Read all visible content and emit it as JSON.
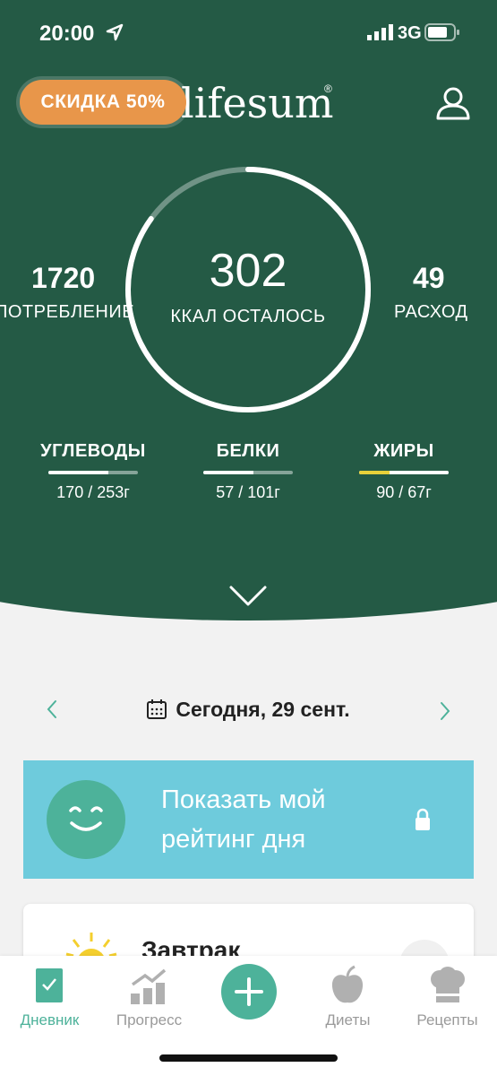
{
  "status_bar": {
    "time": "20:00",
    "network": "3G"
  },
  "header": {
    "promo_label": "СКИДКА 50%",
    "logo_text": "lifesum",
    "calories_remaining": "302",
    "calories_remaining_label": "ККАЛ ОСТАЛОСЬ",
    "consumed_value": "1720",
    "consumed_label": "ПОТРЕБЛЕНИЕ",
    "burned_value": "49",
    "burned_label": "РАСХОД",
    "ring_progress": 0.85,
    "macros": [
      {
        "label": "УГЛЕВОДЫ",
        "value": "170 / 253г",
        "progress": 0.67
      },
      {
        "label": "БЕЛКИ",
        "value": "57 / 101г",
        "progress": 0.56
      },
      {
        "label": "ЖИРЫ",
        "value": "90 / 67г",
        "progress": 1.0
      }
    ]
  },
  "date_nav": {
    "label": "Сегодня, 29 сент."
  },
  "rating_banner": {
    "line1": "Показать мой",
    "line2": "рейтинг дня"
  },
  "meal_card": {
    "title": "Завтрак"
  },
  "tabs": [
    {
      "label": "Дневник",
      "icon": "diary-icon",
      "active": true
    },
    {
      "label": "Прогресс",
      "icon": "progress-icon",
      "active": false
    },
    {
      "label": "",
      "icon": "plus-icon",
      "active": false
    },
    {
      "label": "Диеты",
      "icon": "apple-icon",
      "active": false
    },
    {
      "label": "Рецепты",
      "icon": "chef-hat-icon",
      "active": false
    }
  ],
  "colors": {
    "header": "#245a45",
    "accent": "#4db29a",
    "promo": "#e8964a",
    "banner": "#6ecbdc",
    "fat_over": "#e8d13a"
  }
}
